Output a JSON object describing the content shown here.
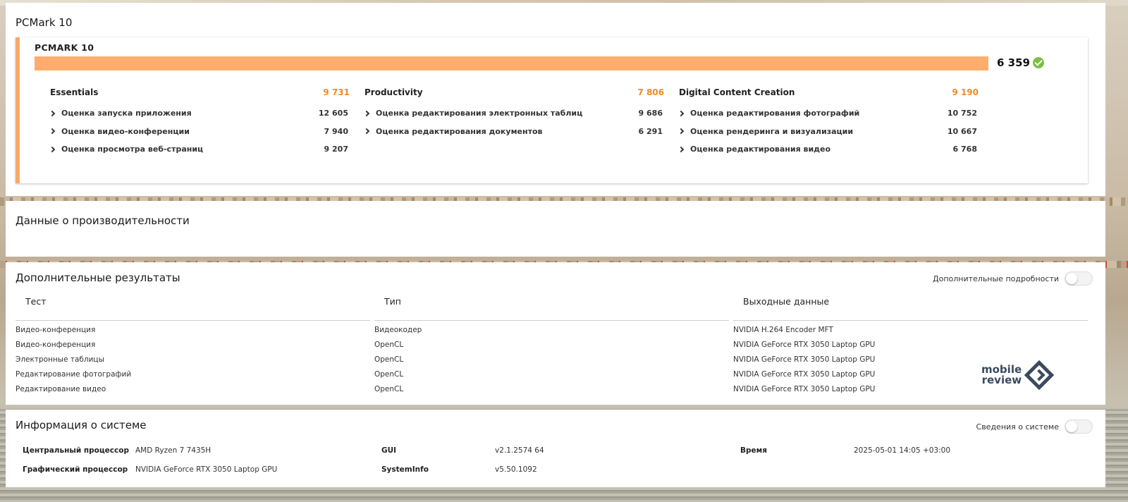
{
  "colors": {
    "accent_orange": "#f08a24",
    "bar_fill": "#ffad6e",
    "card_border": "#f7a96a",
    "check_green": "#7ac142",
    "logo_navy": "#3b4a5e"
  },
  "pcmark_panel": {
    "title": "PCMark 10",
    "card_title": "PCMARK 10",
    "total_score": "6 359",
    "score_bar_fill_percent": 100,
    "status_icon": "check-circle-icon",
    "groups": [
      {
        "name": "Essentials",
        "score": "9 731",
        "items": [
          {
            "label": "Оценка запуска приложения",
            "value": "12 605"
          },
          {
            "label": "Оценка видео-конференции",
            "value": "7 940"
          },
          {
            "label": "Оценка просмотра веб-страниц",
            "value": "9 207"
          }
        ]
      },
      {
        "name": "Productivity",
        "score": "7 806",
        "items": [
          {
            "label": "Оценка редактирования электронных таблиц",
            "value": "9 686"
          },
          {
            "label": "Оценка редактирования документов",
            "value": "6 291"
          }
        ]
      },
      {
        "name": "Digital Content Creation",
        "score": "9 190",
        "items": [
          {
            "label": "Оценка редактирования фотографий",
            "value": "10 752"
          },
          {
            "label": "Оценка рендеринга и визуализации",
            "value": "10 667"
          },
          {
            "label": "Оценка редактирования видео",
            "value": "6 768"
          }
        ]
      }
    ]
  },
  "performance_panel": {
    "title": "Данные о производительности"
  },
  "additional_panel": {
    "title": "Дополнительные результаты",
    "toggle_label": "Дополнительные подробности",
    "columns": [
      "Тест",
      "Тип",
      "Выходные данные"
    ],
    "rows": [
      [
        "Видео-конференция",
        "Видеокодер",
        "NVIDIA H.264 Encoder MFT"
      ],
      [
        "Видео-конференция",
        "OpenCL",
        "NVIDIA GeForce RTX 3050 Laptop GPU"
      ],
      [
        "Электронные таблицы",
        "OpenCL",
        "NVIDIA GeForce RTX 3050 Laptop GPU"
      ],
      [
        "Редактирование фотографий",
        "OpenCL",
        "NVIDIA GeForce RTX 3050 Laptop GPU"
      ],
      [
        "Редактирование видео",
        "OpenCL",
        "NVIDIA GeForce RTX 3050 Laptop GPU"
      ]
    ],
    "watermark": {
      "line1": "mobile",
      "line2": "review"
    }
  },
  "system_panel": {
    "title": "Информация о системе",
    "toggle_label": "Сведения о системе",
    "fields": [
      {
        "label": "Центральный процессор",
        "value": "AMD Ryzen 7 7435H"
      },
      {
        "label": "Графический процессор",
        "value": "NVIDIA GeForce RTX 3050 Laptop GPU"
      },
      {
        "label": "GUI",
        "value": "v2.1.2574 64"
      },
      {
        "label": "SystemInfo",
        "value": "v5.50.1092"
      },
      {
        "label": "Время",
        "value": "2025-05-01 14:05 +03:00"
      }
    ]
  }
}
